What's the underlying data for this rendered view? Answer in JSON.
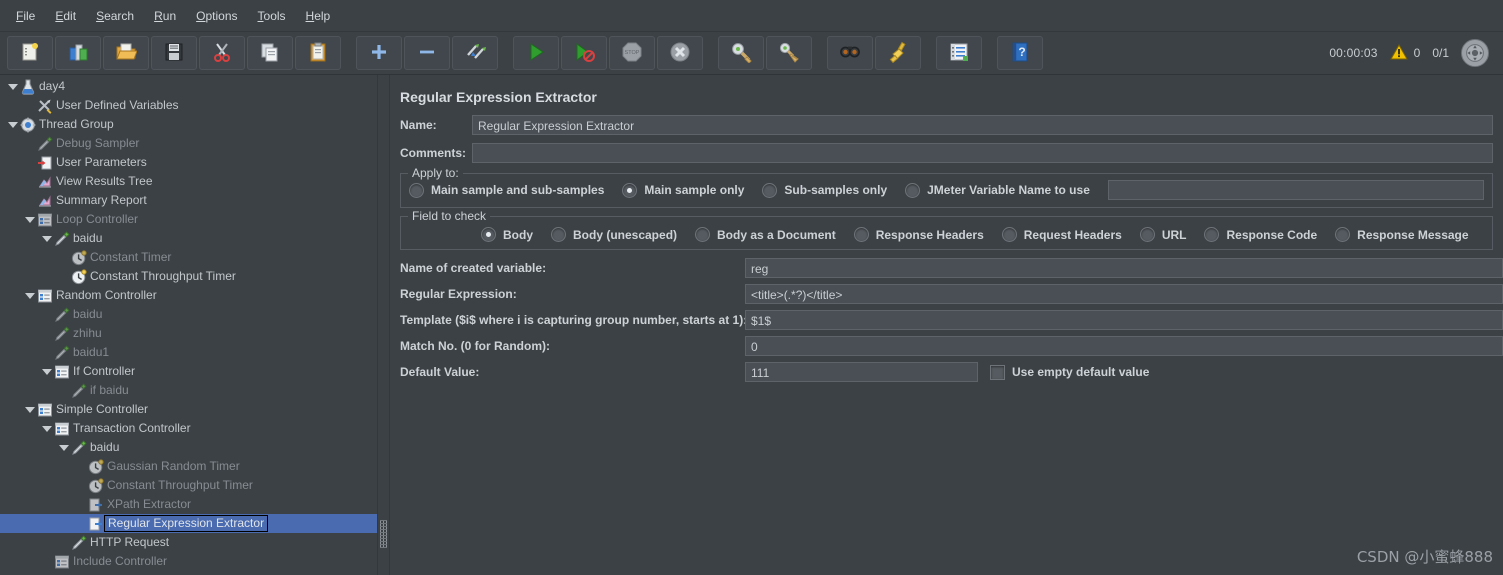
{
  "menu": {
    "items": [
      {
        "label": "File",
        "mnemonic": "F"
      },
      {
        "label": "Edit",
        "mnemonic": "E"
      },
      {
        "label": "Search",
        "mnemonic": "S"
      },
      {
        "label": "Run",
        "mnemonic": "R"
      },
      {
        "label": "Options",
        "mnemonic": "O"
      },
      {
        "label": "Tools",
        "mnemonic": "T"
      },
      {
        "label": "Help",
        "mnemonic": "H"
      }
    ]
  },
  "toolbar": {
    "buttons": [
      {
        "name": "new-icon",
        "title": "New"
      },
      {
        "name": "templates-icon",
        "title": "Templates"
      },
      {
        "name": "open-icon",
        "title": "Open"
      },
      {
        "name": "save-icon",
        "title": "Save"
      },
      {
        "name": "cut-icon",
        "title": "Cut"
      },
      {
        "name": "copy-icon",
        "title": "Copy"
      },
      {
        "name": "paste-icon",
        "title": "Paste"
      },
      {
        "name": "expand-all-icon",
        "title": "Expand All"
      },
      {
        "name": "collapse-all-icon",
        "title": "Collapse All"
      },
      {
        "name": "toggle-icon",
        "title": "Toggle"
      },
      {
        "name": "start-icon",
        "title": "Start"
      },
      {
        "name": "start-no-timers-icon",
        "title": "Start no pauses"
      },
      {
        "name": "stop-icon",
        "title": "Stop"
      },
      {
        "name": "shutdown-icon",
        "title": "Shutdown"
      },
      {
        "name": "clear-icon",
        "title": "Clear"
      },
      {
        "name": "clear-all-icon",
        "title": "Clear All"
      },
      {
        "name": "search-icon",
        "title": "Search"
      },
      {
        "name": "reset-search-icon",
        "title": "Reset Search"
      },
      {
        "name": "log-viewer-icon",
        "title": "Log Viewer"
      },
      {
        "name": "help-icon",
        "title": "Help"
      }
    ],
    "status": {
      "timer": "00:00:03",
      "warnings": "0",
      "threads": "0/1"
    }
  },
  "tree": {
    "nodes": [
      {
        "label": "day4",
        "indent": 0,
        "expanded": true,
        "icon": "test-plan-icon",
        "dim": false,
        "selected": false
      },
      {
        "label": "User Defined Variables",
        "indent": 1,
        "expanded": null,
        "icon": "config-element-icon",
        "dim": false,
        "selected": false
      },
      {
        "label": "Thread Group",
        "indent": 0,
        "expanded": true,
        "icon": "thread-group-icon",
        "dim": false,
        "selected": false
      },
      {
        "label": "Debug Sampler",
        "indent": 1,
        "expanded": null,
        "icon": "sampler-icon",
        "dim": true,
        "selected": false
      },
      {
        "label": "User Parameters",
        "indent": 1,
        "expanded": null,
        "icon": "pre-processor-icon",
        "dim": false,
        "selected": false
      },
      {
        "label": "View Results Tree",
        "indent": 1,
        "expanded": null,
        "icon": "listener-icon",
        "dim": false,
        "selected": false
      },
      {
        "label": "Summary Report",
        "indent": 1,
        "expanded": null,
        "icon": "listener-icon",
        "dim": false,
        "selected": false
      },
      {
        "label": "Loop Controller",
        "indent": 1,
        "expanded": true,
        "icon": "controller-icon",
        "dim": true,
        "selected": false
      },
      {
        "label": "baidu",
        "indent": 2,
        "expanded": true,
        "icon": "sampler-icon",
        "dim": false,
        "selected": false
      },
      {
        "label": "Constant Timer",
        "indent": 3,
        "expanded": null,
        "icon": "timer-icon",
        "dim": true,
        "selected": false
      },
      {
        "label": "Constant Throughput Timer",
        "indent": 3,
        "expanded": null,
        "icon": "timer-icon",
        "dim": false,
        "selected": false
      },
      {
        "label": "Random Controller",
        "indent": 1,
        "expanded": true,
        "icon": "controller-icon",
        "dim": false,
        "selected": false
      },
      {
        "label": "baidu",
        "indent": 2,
        "expanded": null,
        "icon": "sampler-icon",
        "dim": true,
        "selected": false
      },
      {
        "label": "zhihu",
        "indent": 2,
        "expanded": null,
        "icon": "sampler-icon",
        "dim": true,
        "selected": false
      },
      {
        "label": "baidu1",
        "indent": 2,
        "expanded": null,
        "icon": "sampler-icon",
        "dim": true,
        "selected": false
      },
      {
        "label": "If Controller",
        "indent": 2,
        "expanded": true,
        "icon": "controller-icon",
        "dim": false,
        "selected": false
      },
      {
        "label": "if baidu",
        "indent": 3,
        "expanded": null,
        "icon": "sampler-icon",
        "dim": true,
        "selected": false
      },
      {
        "label": "Simple Controller",
        "indent": 1,
        "expanded": true,
        "icon": "controller-icon",
        "dim": false,
        "selected": false
      },
      {
        "label": "Transaction Controller",
        "indent": 2,
        "expanded": true,
        "icon": "controller-icon",
        "dim": false,
        "selected": false
      },
      {
        "label": "baidu",
        "indent": 3,
        "expanded": true,
        "icon": "sampler-icon",
        "dim": false,
        "selected": false
      },
      {
        "label": "Gaussian Random Timer",
        "indent": 4,
        "expanded": null,
        "icon": "timer-icon",
        "dim": true,
        "selected": false
      },
      {
        "label": "Constant Throughput Timer",
        "indent": 4,
        "expanded": null,
        "icon": "timer-icon",
        "dim": true,
        "selected": false
      },
      {
        "label": "XPath Extractor",
        "indent": 4,
        "expanded": null,
        "icon": "post-processor-icon",
        "dim": true,
        "selected": false
      },
      {
        "label": "Regular Expression Extractor",
        "indent": 4,
        "expanded": null,
        "icon": "post-processor-icon",
        "dim": false,
        "selected": true
      },
      {
        "label": "HTTP Request",
        "indent": 3,
        "expanded": null,
        "icon": "sampler-icon",
        "dim": false,
        "selected": false
      },
      {
        "label": "Include Controller",
        "indent": 2,
        "expanded": null,
        "icon": "controller-icon",
        "dim": true,
        "selected": false
      }
    ]
  },
  "panel": {
    "title": "Regular Expression Extractor",
    "name_label": "Name:",
    "name_value": "Regular Expression Extractor",
    "comments_label": "Comments:",
    "comments_value": "",
    "apply_to": {
      "legend": "Apply to:",
      "options": [
        {
          "label": "Main sample and sub-samples",
          "selected": false
        },
        {
          "label": "Main sample only",
          "selected": true
        },
        {
          "label": "Sub-samples only",
          "selected": false
        },
        {
          "label": "JMeter Variable Name to use",
          "selected": false
        }
      ],
      "variable_value": ""
    },
    "field_to_check": {
      "legend": "Field to check",
      "options": [
        {
          "label": "Body",
          "selected": true
        },
        {
          "label": "Body (unescaped)",
          "selected": false
        },
        {
          "label": "Body as a Document",
          "selected": false
        },
        {
          "label": "Response Headers",
          "selected": false
        },
        {
          "label": "Request Headers",
          "selected": false
        },
        {
          "label": "URL",
          "selected": false
        },
        {
          "label": "Response Code",
          "selected": false
        },
        {
          "label": "Response Message",
          "selected": false
        }
      ]
    },
    "fields": [
      {
        "label": "Name of created variable:",
        "value": "reg"
      },
      {
        "label": "Regular Expression:",
        "value": "<title>(.*?)</title>"
      },
      {
        "label": "Template ($i$ where i is capturing group number, starts at 1):",
        "value": "$1$"
      },
      {
        "label": "Match No. (0 for Random):",
        "value": "0"
      },
      {
        "label": "Default Value:",
        "value": "111"
      }
    ],
    "use_empty_default": {
      "label": "Use empty default value",
      "checked": false
    }
  },
  "watermark": "CSDN @小蜜蜂888",
  "colors": {
    "background": "#3c4146",
    "selection": "#4a6bb0",
    "text": "#c8cdd2",
    "dim_text": "#868c92",
    "field_bg": "#4a4f55",
    "warning": "#f5c518"
  }
}
